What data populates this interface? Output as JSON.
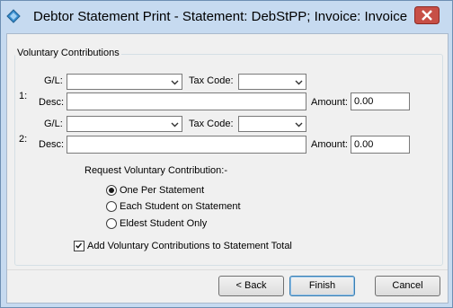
{
  "window": {
    "title": "Debtor Statement Print  - Statement: DebStPP;  Invoice: Invoice"
  },
  "group": {
    "title": "Voluntary Contributions",
    "rows": [
      {
        "number": "1:",
        "gl_label": "G/L:",
        "gl_value": "",
        "tax_label": "Tax Code:",
        "tax_value": "",
        "desc_label": "Desc:",
        "desc_value": "",
        "amount_label": "Amount:",
        "amount_value": "0.00"
      },
      {
        "number": "2:",
        "gl_label": "G/L:",
        "gl_value": "",
        "tax_label": "Tax Code:",
        "tax_value": "",
        "desc_label": "Desc:",
        "desc_value": "",
        "amount_label": "Amount:",
        "amount_value": "0.00"
      }
    ],
    "request_label": "Request Voluntary Contribution:-",
    "options": [
      {
        "label": "One Per Statement",
        "selected": true
      },
      {
        "label": "Each Student on Statement",
        "selected": false
      },
      {
        "label": "Eldest Student Only",
        "selected": false
      }
    ],
    "add_to_total": {
      "label": "Add Voluntary Contributions to Statement Total",
      "checked": true
    }
  },
  "buttons": {
    "back": "< Back",
    "finish": "Finish",
    "cancel": "Cancel"
  },
  "colors": {
    "titlebar": "#c6daf0",
    "close": "#c74f46",
    "client": "#f0f0f0",
    "default_border": "#3c7fb1"
  },
  "icons": {
    "app": "diamond-app-icon",
    "close": "close-icon",
    "dropdown": "chevron-down-icon",
    "check": "checkmark-icon"
  }
}
